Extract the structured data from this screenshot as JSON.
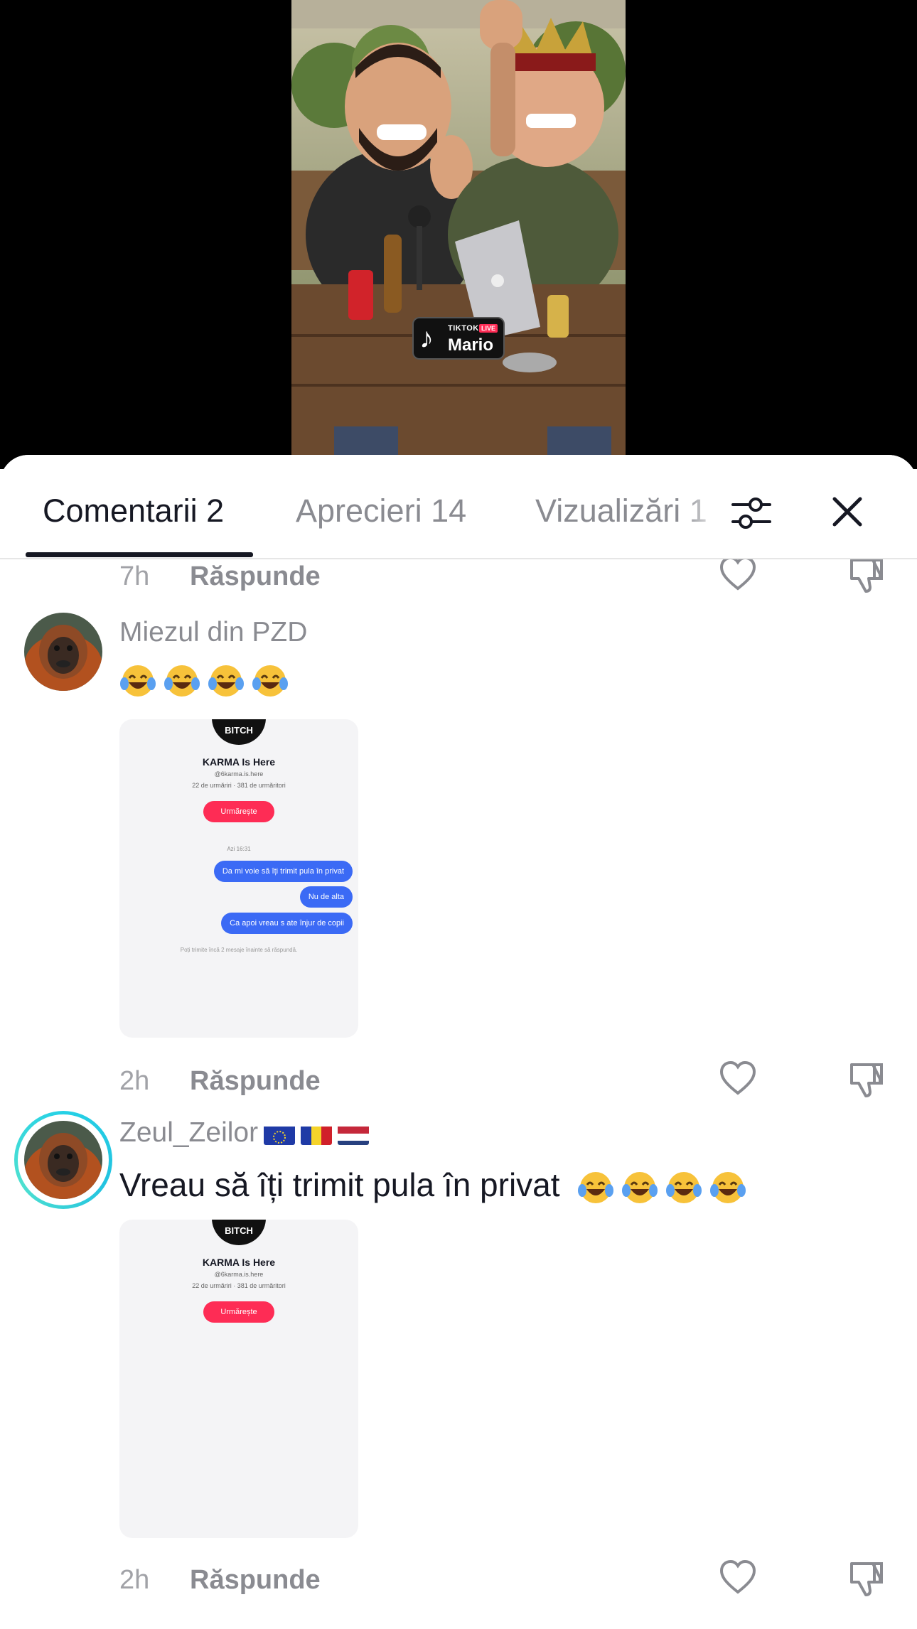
{
  "video": {
    "live_badge": {
      "brand": "TIKTOK",
      "live": "LIVE",
      "name": "Mario"
    }
  },
  "tabs": [
    {
      "label": "Comentarii 2"
    },
    {
      "label": "Aprecieri 14"
    },
    {
      "label": "Vizualizări 1"
    }
  ],
  "icons": {
    "filter": "sliders-icon",
    "close": "close-icon",
    "like": "heart-icon",
    "dislike": "thumbs-down-icon"
  },
  "comments": {
    "prev_meta": {
      "time": "7h",
      "reply": "Răspunde"
    },
    "items": [
      {
        "username": "Miezul din PZD",
        "text": "",
        "emojis": [
          "laughing-tears",
          "laughing-tears",
          "laughing-tears",
          "laughing-tears"
        ],
        "attachment": {
          "badge": "BITCH",
          "title": "KARMA Is Here",
          "handle": "@6karma.is.here",
          "stats": "22 de urmăriri · 381 de urmăritori",
          "follow": "Urmărește",
          "date": "Azi 16:31",
          "messages": [
            "Da mi voie să îți trimit pula în privat",
            "Nu de alta",
            "Ca apoi vreau s ate înjur de copii"
          ],
          "note": "Poți trimite încă 2 mesaje înainte să răspundă."
        },
        "time": "2h",
        "reply": "Răspunde"
      },
      {
        "username": "Zeul_Zeilor",
        "flags": [
          "eu-flag",
          "romania-flag",
          "netherlands-flag"
        ],
        "text": "Vreau să îți trimit pula în privat",
        "emojis": [
          "laughing-tears",
          "laughing-tears",
          "laughing-tears",
          "laughing-tears"
        ],
        "attachment": {
          "badge": "BITCH",
          "title": "KARMA Is Here",
          "handle": "@6karma.is.here",
          "stats": "22 de urmăriri · 381 de urmăritori",
          "follow": "Urmărește"
        },
        "time": "2h",
        "reply": "Răspunde"
      }
    ]
  },
  "colors": {
    "text_primary": "#161823",
    "text_secondary": "#8a8b91",
    "follow_red": "#fe2c55",
    "bubble_blue": "#3b6af5",
    "story_ring": "#25d1e6"
  }
}
